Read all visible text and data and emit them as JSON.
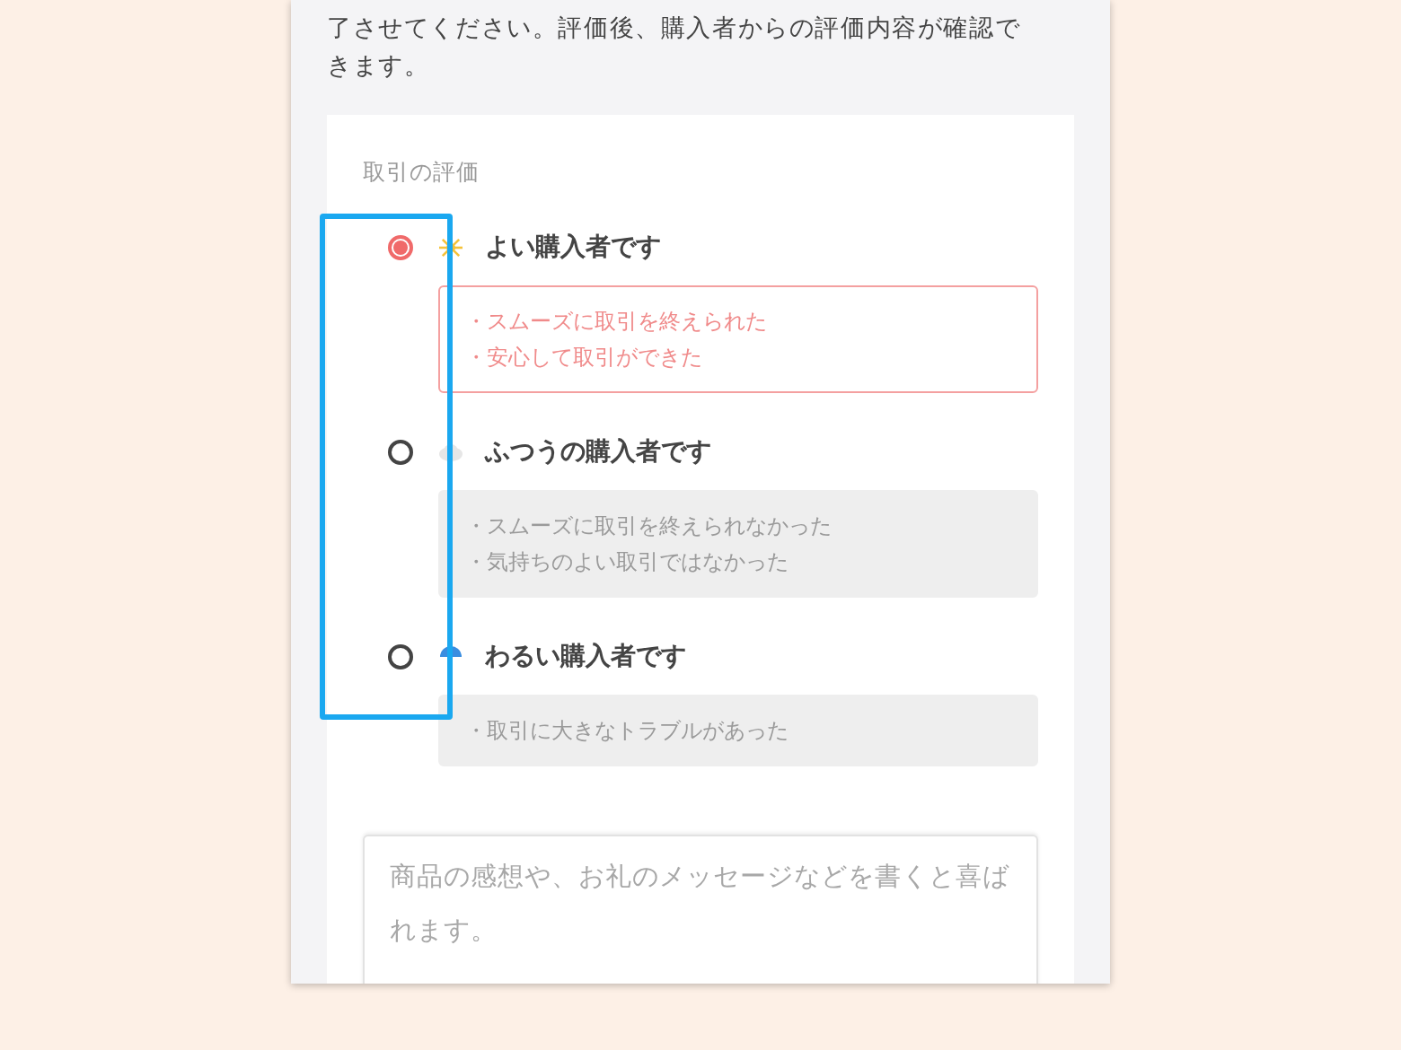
{
  "intro": "了させてください。評価後、購入者からの評価内容が確認できます。",
  "rating": {
    "title": "取引の評価",
    "options": [
      {
        "kind": "good",
        "label": "よい購入者です",
        "selected": true,
        "reasons": [
          "・スムーズに取引を終えられた",
          "・安心して取引ができた"
        ]
      },
      {
        "kind": "normal",
        "label": "ふつうの購入者です",
        "selected": false,
        "reasons": [
          "・スムーズに取引を終えられなかった",
          "・気持ちのよい取引ではなかった"
        ]
      },
      {
        "kind": "bad",
        "label": "わるい購入者です",
        "selected": false,
        "reasons": [
          "・取引に大きなトラブルがあった"
        ]
      }
    ]
  },
  "comment": {
    "placeholder": "商品の感想や、お礼のメッセージなどを書くと喜ばれます。"
  }
}
